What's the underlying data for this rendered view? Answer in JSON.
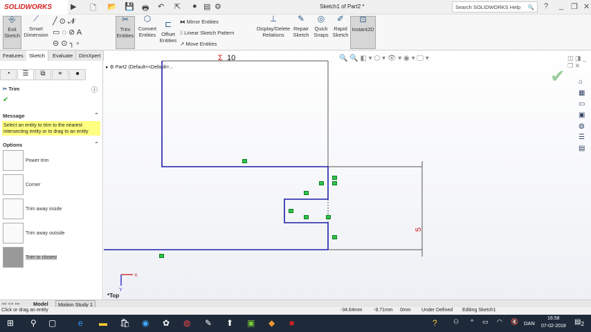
{
  "app": {
    "brand": "SOLIDWORKS",
    "title": "Sketch1 of Part2 *",
    "search_placeholder": "Search SOLIDWORKS Help"
  },
  "ribbon": {
    "exit_sketch": "Exit Sketch",
    "smart_dimension": "Smart Dimension",
    "trim_entities": "Trim Entities",
    "convert_entities": "Convert Entities",
    "offset_entities": "Offset Entities",
    "mirror": "Mirror Entities",
    "linear_pattern": "Linear Sketch Pattern",
    "move": "Move Entities",
    "display_delete": "Display/Delete Relations",
    "repair": "Repair Sketch",
    "quick_snaps": "Quick Snaps",
    "rapid_sketch": "Rapid Sketch",
    "instant2d": "Instant2D"
  },
  "tabs": [
    "Features",
    "Sketch",
    "Evaluate",
    "DimXpert"
  ],
  "panel": {
    "title": "Trim",
    "message_header": "Message",
    "message": "Select an entity to trim to the nearest intersecting entity or to drag to an entity",
    "options_header": "Options",
    "options": [
      "Power trim",
      "Corner",
      "Trim away inside",
      "Trim away outside",
      "Trim to closest"
    ]
  },
  "tree": {
    "item": "Part2  (Default<<Default>..."
  },
  "canvas": {
    "dim_top": "10",
    "dim_right": "5",
    "view": "*Top",
    "triad_x": "X",
    "triad_y": "Y"
  },
  "bottom_tabs": [
    "Model",
    "Motion Study 1"
  ],
  "status": {
    "hint": "Click or drag an entity",
    "x": "-34.64mm",
    "y": "-9.71mm",
    "z": "0mm",
    "state": "Under Defined",
    "mode": "Editing Sketch1"
  },
  "taskbar": {
    "lang": "DAN",
    "time": "16:58",
    "date": "07-02-2018",
    "notif": "2"
  },
  "colors": {
    "sketch": "#1c1ca8",
    "marker": "#2ec44a",
    "dim": "#cc1111"
  }
}
